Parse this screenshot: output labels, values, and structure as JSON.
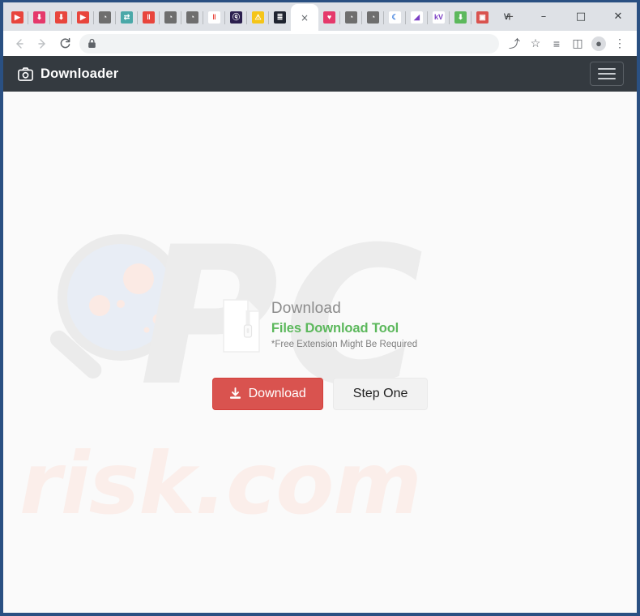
{
  "browser": {
    "tabs": [
      {
        "name": "tab-youtube",
        "icon": "youtube-favicon",
        "bg": "#e8453c",
        "glyph": "▶"
      },
      {
        "name": "tab-download-1",
        "icon": "download-pink-favicon",
        "bg": "#e5396b",
        "glyph": "⬇"
      },
      {
        "name": "tab-download-2",
        "icon": "download-red-favicon",
        "bg": "#e8453c",
        "glyph": "⬇"
      },
      {
        "name": "tab-media-red",
        "icon": "media-red-favicon",
        "bg": "#e8453c",
        "glyph": "▶"
      },
      {
        "name": "tab-globe-1",
        "icon": "globe-favicon",
        "bg": "#6e6e6e",
        "glyph": "◔"
      },
      {
        "name": "tab-sync",
        "icon": "sync-teal-favicon",
        "bg": "#4aa8a8",
        "glyph": "⇄"
      },
      {
        "name": "tab-wave",
        "icon": "waveform-favicon",
        "bg": "#e8453c",
        "glyph": "‖"
      },
      {
        "name": "tab-globe-2",
        "icon": "globe-favicon",
        "bg": "#6e6e6e",
        "glyph": "◔"
      },
      {
        "name": "tab-globe-3",
        "icon": "globe-favicon",
        "bg": "#6e6e6e",
        "glyph": "◔"
      },
      {
        "name": "tab-pause",
        "icon": "pause-bars-favicon",
        "bg": "#ffffff",
        "glyph": "‖",
        "fg": "#e8453c"
      },
      {
        "name": "tab-search-dark",
        "icon": "search-dark-favicon",
        "bg": "#2b1f4e",
        "glyph": "ⓠ"
      },
      {
        "name": "tab-warning",
        "icon": "warning-favicon",
        "bg": "#f5c518",
        "glyph": "⚠"
      },
      {
        "name": "tab-glyph-dark",
        "icon": "script-dark-favicon",
        "bg": "#1f2430",
        "glyph": "≣"
      },
      {
        "name": "tab-active",
        "icon": "active-tab",
        "bg": "#ffffff",
        "glyph": "",
        "active": true,
        "close": "×"
      },
      {
        "name": "tab-heart-pink",
        "icon": "heart-pink-favicon",
        "bg": "#e5396b",
        "glyph": "♥"
      },
      {
        "name": "tab-globe-4",
        "icon": "globe-favicon",
        "bg": "#6e6e6e",
        "glyph": "◔"
      },
      {
        "name": "tab-globe-5",
        "icon": "globe-favicon",
        "bg": "#6e6e6e",
        "glyph": "◔"
      },
      {
        "name": "tab-crescent",
        "icon": "crescent-blue-favicon",
        "bg": "#ffffff",
        "glyph": "☾",
        "fg": "#3b7ddd"
      },
      {
        "name": "tab-purple",
        "icon": "purple-mark-favicon",
        "bg": "#ffffff",
        "glyph": "◢",
        "fg": "#7b3fc4"
      },
      {
        "name": "tab-kv",
        "icon": "kv-favicon",
        "bg": "#ffffff",
        "glyph": "kV",
        "fg": "#7b3fc4"
      },
      {
        "name": "tab-download-3",
        "icon": "download-green-favicon",
        "bg": "#5cb85c",
        "glyph": "⬇"
      },
      {
        "name": "tab-app-red",
        "icon": "app-red-favicon",
        "bg": "#d9534f",
        "glyph": "▣"
      }
    ],
    "new_tab_label": "+",
    "window_controls": [
      {
        "name": "tab-search-button",
        "glyph": "∨"
      },
      {
        "name": "minimize-button",
        "glyph": "–"
      },
      {
        "name": "maximize-button",
        "glyph": "□"
      },
      {
        "name": "close-window-button",
        "glyph": "✕"
      }
    ],
    "toolbar": {
      "back": "←",
      "forward": "→",
      "reload": "⟳",
      "lock": "🔒",
      "url": "",
      "url_placeholder": "",
      "right_icons": [
        {
          "name": "share-icon",
          "glyph": "⤴"
        },
        {
          "name": "bookmark-star-icon",
          "glyph": "☆"
        },
        {
          "name": "reading-list-icon",
          "glyph": "≡"
        },
        {
          "name": "side-panel-icon",
          "glyph": "◫"
        },
        {
          "name": "profile-avatar",
          "glyph": "●"
        },
        {
          "name": "browser-menu-icon",
          "glyph": "⋮"
        }
      ]
    }
  },
  "app": {
    "header": {
      "title": "Downloader",
      "camera_icon": "camera-icon",
      "menu_icon": "hamburger-icon"
    },
    "watermarks": {
      "pc": "PC",
      "risk": "risk.com"
    },
    "promo": {
      "heading": "Download",
      "subheading": "Files Download Tool",
      "note": "*Free Extension Might Be Required",
      "file_icon": "file-zip-icon"
    },
    "buttons": {
      "download": "Download",
      "download_icon": "download-icon",
      "step_one": "Step One"
    },
    "colors": {
      "header_bg": "#343a40",
      "download_red": "#d9534f",
      "tool_green": "#5cb85c",
      "page_bg": "#fafafa",
      "frame_blue": "#2a5082"
    }
  }
}
